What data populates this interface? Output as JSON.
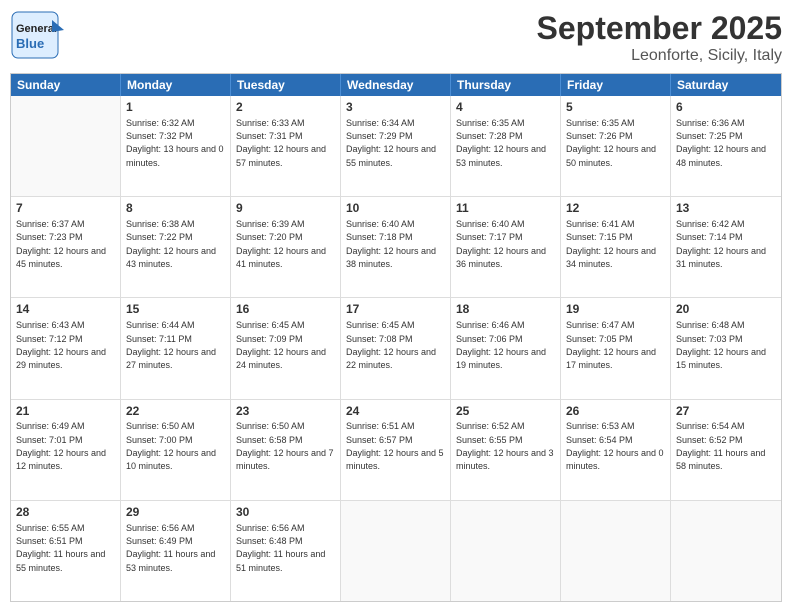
{
  "header": {
    "logo_general": "General",
    "logo_blue": "Blue",
    "title": "September 2025",
    "subtitle": "Leonforte, Sicily, Italy"
  },
  "days_of_week": [
    "Sunday",
    "Monday",
    "Tuesday",
    "Wednesday",
    "Thursday",
    "Friday",
    "Saturday"
  ],
  "weeks": [
    [
      {
        "day": "",
        "sunrise": "",
        "sunset": "",
        "daylight": ""
      },
      {
        "day": "1",
        "sunrise": "Sunrise: 6:32 AM",
        "sunset": "Sunset: 7:32 PM",
        "daylight": "Daylight: 13 hours and 0 minutes."
      },
      {
        "day": "2",
        "sunrise": "Sunrise: 6:33 AM",
        "sunset": "Sunset: 7:31 PM",
        "daylight": "Daylight: 12 hours and 57 minutes."
      },
      {
        "day": "3",
        "sunrise": "Sunrise: 6:34 AM",
        "sunset": "Sunset: 7:29 PM",
        "daylight": "Daylight: 12 hours and 55 minutes."
      },
      {
        "day": "4",
        "sunrise": "Sunrise: 6:35 AM",
        "sunset": "Sunset: 7:28 PM",
        "daylight": "Daylight: 12 hours and 53 minutes."
      },
      {
        "day": "5",
        "sunrise": "Sunrise: 6:35 AM",
        "sunset": "Sunset: 7:26 PM",
        "daylight": "Daylight: 12 hours and 50 minutes."
      },
      {
        "day": "6",
        "sunrise": "Sunrise: 6:36 AM",
        "sunset": "Sunset: 7:25 PM",
        "daylight": "Daylight: 12 hours and 48 minutes."
      }
    ],
    [
      {
        "day": "7",
        "sunrise": "Sunrise: 6:37 AM",
        "sunset": "Sunset: 7:23 PM",
        "daylight": "Daylight: 12 hours and 45 minutes."
      },
      {
        "day": "8",
        "sunrise": "Sunrise: 6:38 AM",
        "sunset": "Sunset: 7:22 PM",
        "daylight": "Daylight: 12 hours and 43 minutes."
      },
      {
        "day": "9",
        "sunrise": "Sunrise: 6:39 AM",
        "sunset": "Sunset: 7:20 PM",
        "daylight": "Daylight: 12 hours and 41 minutes."
      },
      {
        "day": "10",
        "sunrise": "Sunrise: 6:40 AM",
        "sunset": "Sunset: 7:18 PM",
        "daylight": "Daylight: 12 hours and 38 minutes."
      },
      {
        "day": "11",
        "sunrise": "Sunrise: 6:40 AM",
        "sunset": "Sunset: 7:17 PM",
        "daylight": "Daylight: 12 hours and 36 minutes."
      },
      {
        "day": "12",
        "sunrise": "Sunrise: 6:41 AM",
        "sunset": "Sunset: 7:15 PM",
        "daylight": "Daylight: 12 hours and 34 minutes."
      },
      {
        "day": "13",
        "sunrise": "Sunrise: 6:42 AM",
        "sunset": "Sunset: 7:14 PM",
        "daylight": "Daylight: 12 hours and 31 minutes."
      }
    ],
    [
      {
        "day": "14",
        "sunrise": "Sunrise: 6:43 AM",
        "sunset": "Sunset: 7:12 PM",
        "daylight": "Daylight: 12 hours and 29 minutes."
      },
      {
        "day": "15",
        "sunrise": "Sunrise: 6:44 AM",
        "sunset": "Sunset: 7:11 PM",
        "daylight": "Daylight: 12 hours and 27 minutes."
      },
      {
        "day": "16",
        "sunrise": "Sunrise: 6:45 AM",
        "sunset": "Sunset: 7:09 PM",
        "daylight": "Daylight: 12 hours and 24 minutes."
      },
      {
        "day": "17",
        "sunrise": "Sunrise: 6:45 AM",
        "sunset": "Sunset: 7:08 PM",
        "daylight": "Daylight: 12 hours and 22 minutes."
      },
      {
        "day": "18",
        "sunrise": "Sunrise: 6:46 AM",
        "sunset": "Sunset: 7:06 PM",
        "daylight": "Daylight: 12 hours and 19 minutes."
      },
      {
        "day": "19",
        "sunrise": "Sunrise: 6:47 AM",
        "sunset": "Sunset: 7:05 PM",
        "daylight": "Daylight: 12 hours and 17 minutes."
      },
      {
        "day": "20",
        "sunrise": "Sunrise: 6:48 AM",
        "sunset": "Sunset: 7:03 PM",
        "daylight": "Daylight: 12 hours and 15 minutes."
      }
    ],
    [
      {
        "day": "21",
        "sunrise": "Sunrise: 6:49 AM",
        "sunset": "Sunset: 7:01 PM",
        "daylight": "Daylight: 12 hours and 12 minutes."
      },
      {
        "day": "22",
        "sunrise": "Sunrise: 6:50 AM",
        "sunset": "Sunset: 7:00 PM",
        "daylight": "Daylight: 12 hours and 10 minutes."
      },
      {
        "day": "23",
        "sunrise": "Sunrise: 6:50 AM",
        "sunset": "Sunset: 6:58 PM",
        "daylight": "Daylight: 12 hours and 7 minutes."
      },
      {
        "day": "24",
        "sunrise": "Sunrise: 6:51 AM",
        "sunset": "Sunset: 6:57 PM",
        "daylight": "Daylight: 12 hours and 5 minutes."
      },
      {
        "day": "25",
        "sunrise": "Sunrise: 6:52 AM",
        "sunset": "Sunset: 6:55 PM",
        "daylight": "Daylight: 12 hours and 3 minutes."
      },
      {
        "day": "26",
        "sunrise": "Sunrise: 6:53 AM",
        "sunset": "Sunset: 6:54 PM",
        "daylight": "Daylight: 12 hours and 0 minutes."
      },
      {
        "day": "27",
        "sunrise": "Sunrise: 6:54 AM",
        "sunset": "Sunset: 6:52 PM",
        "daylight": "Daylight: 11 hours and 58 minutes."
      }
    ],
    [
      {
        "day": "28",
        "sunrise": "Sunrise: 6:55 AM",
        "sunset": "Sunset: 6:51 PM",
        "daylight": "Daylight: 11 hours and 55 minutes."
      },
      {
        "day": "29",
        "sunrise": "Sunrise: 6:56 AM",
        "sunset": "Sunset: 6:49 PM",
        "daylight": "Daylight: 11 hours and 53 minutes."
      },
      {
        "day": "30",
        "sunrise": "Sunrise: 6:56 AM",
        "sunset": "Sunset: 6:48 PM",
        "daylight": "Daylight: 11 hours and 51 minutes."
      },
      {
        "day": "",
        "sunrise": "",
        "sunset": "",
        "daylight": ""
      },
      {
        "day": "",
        "sunrise": "",
        "sunset": "",
        "daylight": ""
      },
      {
        "day": "",
        "sunrise": "",
        "sunset": "",
        "daylight": ""
      },
      {
        "day": "",
        "sunrise": "",
        "sunset": "",
        "daylight": ""
      }
    ]
  ]
}
